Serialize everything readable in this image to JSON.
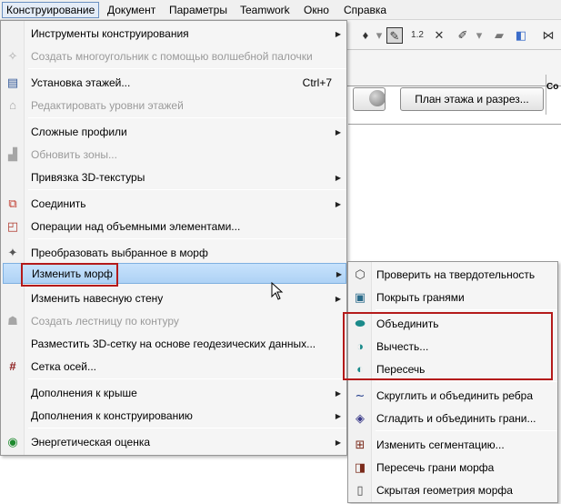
{
  "menubar": {
    "items": [
      {
        "label": "Конструирование"
      },
      {
        "label": "Документ"
      },
      {
        "label": "Параметры"
      },
      {
        "label": "Teamwork"
      },
      {
        "label": "Окно"
      },
      {
        "label": "Справка"
      }
    ]
  },
  "toolbar": {
    "plan_button": "План этажа и разрез...",
    "co_label": "Со"
  },
  "main_menu": {
    "items": [
      {
        "label": "Инструменты конструирования",
        "icon": "none",
        "submenu": true
      },
      {
        "label": "Создать многоугольник с помощью волшебной палочки",
        "icon": "magic-wand-icon",
        "disabled": true
      },
      {
        "label": "Установка этажей...",
        "icon": "stories-icon",
        "shortcut": "Ctrl+7"
      },
      {
        "label": "Редактировать уровни этажей",
        "icon": "levels-icon",
        "disabled": true
      },
      {
        "label": "Сложные профили",
        "icon": "none",
        "submenu": true
      },
      {
        "label": "Обновить зоны...",
        "icon": "zones-icon",
        "disabled": true
      },
      {
        "label": "Привязка 3D-текстуры",
        "icon": "none",
        "submenu": true
      },
      {
        "label": "Соединить",
        "icon": "connect-icon",
        "submenu": true
      },
      {
        "label": "Операции над объемными элементами...",
        "icon": "solid-ops-icon"
      },
      {
        "label": "Преобразовать выбранное в морф",
        "icon": "convert-morph-icon"
      },
      {
        "label": "Изменить морф",
        "icon": "none",
        "submenu": true,
        "highlighted": true
      },
      {
        "label": "Изменить навесную стену",
        "icon": "none",
        "submenu": true
      },
      {
        "label": "Создать лестницу по контуру",
        "icon": "stair-icon",
        "disabled": true
      },
      {
        "label": "Разместить 3D-сетку на основе геодезических данных...",
        "icon": "none"
      },
      {
        "label": "Сетка осей...",
        "icon": "grid-axes-icon"
      },
      {
        "label": "Дополнения к крыше",
        "icon": "none",
        "submenu": true
      },
      {
        "label": "Дополнения к конструированию",
        "icon": "none",
        "submenu": true
      },
      {
        "label": "Энергетическая оценка",
        "icon": "energy-icon",
        "submenu": true
      }
    ]
  },
  "sub_menu": {
    "items": [
      {
        "label": "Проверить на твердотельность",
        "icon": "check-solid-icon"
      },
      {
        "label": "Покрыть гранями",
        "icon": "cover-faces-icon"
      },
      {
        "label": "Объединить",
        "icon": "union-icon"
      },
      {
        "label": "Вычесть...",
        "icon": "subtract-icon"
      },
      {
        "label": "Пересечь",
        "icon": "intersect-icon"
      },
      {
        "label": "Скруглить и объединить ребра",
        "icon": "fillet-edges-icon"
      },
      {
        "label": "Сгладить и объединить грани...",
        "icon": "smooth-faces-icon"
      },
      {
        "label": "Изменить сегментацию...",
        "icon": "segmentation-icon"
      },
      {
        "label": "Пересечь грани морфа",
        "icon": "intersect-faces-icon"
      },
      {
        "label": "Скрытая геометрия морфа",
        "icon": "hidden-geometry-icon"
      }
    ]
  },
  "colors": {
    "highlight": "#aed2f5",
    "annotation_border": "#b41a1a",
    "disabled_text": "#9a9a9a"
  }
}
